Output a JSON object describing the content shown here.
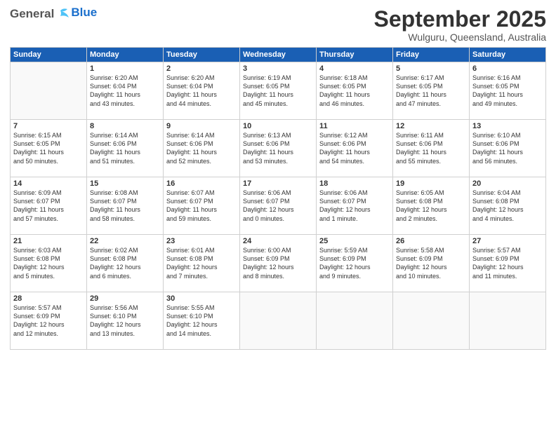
{
  "header": {
    "logo_general": "General",
    "logo_blue": "Blue",
    "month_title": "September 2025",
    "subtitle": "Wulguru, Queensland, Australia"
  },
  "days_of_week": [
    "Sunday",
    "Monday",
    "Tuesday",
    "Wednesday",
    "Thursday",
    "Friday",
    "Saturday"
  ],
  "weeks": [
    [
      {
        "day": "",
        "info": ""
      },
      {
        "day": "1",
        "info": "Sunrise: 6:20 AM\nSunset: 6:04 PM\nDaylight: 11 hours\nand 43 minutes."
      },
      {
        "day": "2",
        "info": "Sunrise: 6:20 AM\nSunset: 6:04 PM\nDaylight: 11 hours\nand 44 minutes."
      },
      {
        "day": "3",
        "info": "Sunrise: 6:19 AM\nSunset: 6:05 PM\nDaylight: 11 hours\nand 45 minutes."
      },
      {
        "day": "4",
        "info": "Sunrise: 6:18 AM\nSunset: 6:05 PM\nDaylight: 11 hours\nand 46 minutes."
      },
      {
        "day": "5",
        "info": "Sunrise: 6:17 AM\nSunset: 6:05 PM\nDaylight: 11 hours\nand 47 minutes."
      },
      {
        "day": "6",
        "info": "Sunrise: 6:16 AM\nSunset: 6:05 PM\nDaylight: 11 hours\nand 49 minutes."
      }
    ],
    [
      {
        "day": "7",
        "info": "Sunrise: 6:15 AM\nSunset: 6:05 PM\nDaylight: 11 hours\nand 50 minutes."
      },
      {
        "day": "8",
        "info": "Sunrise: 6:14 AM\nSunset: 6:06 PM\nDaylight: 11 hours\nand 51 minutes."
      },
      {
        "day": "9",
        "info": "Sunrise: 6:14 AM\nSunset: 6:06 PM\nDaylight: 11 hours\nand 52 minutes."
      },
      {
        "day": "10",
        "info": "Sunrise: 6:13 AM\nSunset: 6:06 PM\nDaylight: 11 hours\nand 53 minutes."
      },
      {
        "day": "11",
        "info": "Sunrise: 6:12 AM\nSunset: 6:06 PM\nDaylight: 11 hours\nand 54 minutes."
      },
      {
        "day": "12",
        "info": "Sunrise: 6:11 AM\nSunset: 6:06 PM\nDaylight: 11 hours\nand 55 minutes."
      },
      {
        "day": "13",
        "info": "Sunrise: 6:10 AM\nSunset: 6:06 PM\nDaylight: 11 hours\nand 56 minutes."
      }
    ],
    [
      {
        "day": "14",
        "info": "Sunrise: 6:09 AM\nSunset: 6:07 PM\nDaylight: 11 hours\nand 57 minutes."
      },
      {
        "day": "15",
        "info": "Sunrise: 6:08 AM\nSunset: 6:07 PM\nDaylight: 11 hours\nand 58 minutes."
      },
      {
        "day": "16",
        "info": "Sunrise: 6:07 AM\nSunset: 6:07 PM\nDaylight: 11 hours\nand 59 minutes."
      },
      {
        "day": "17",
        "info": "Sunrise: 6:06 AM\nSunset: 6:07 PM\nDaylight: 12 hours\nand 0 minutes."
      },
      {
        "day": "18",
        "info": "Sunrise: 6:06 AM\nSunset: 6:07 PM\nDaylight: 12 hours\nand 1 minute."
      },
      {
        "day": "19",
        "info": "Sunrise: 6:05 AM\nSunset: 6:08 PM\nDaylight: 12 hours\nand 2 minutes."
      },
      {
        "day": "20",
        "info": "Sunrise: 6:04 AM\nSunset: 6:08 PM\nDaylight: 12 hours\nand 4 minutes."
      }
    ],
    [
      {
        "day": "21",
        "info": "Sunrise: 6:03 AM\nSunset: 6:08 PM\nDaylight: 12 hours\nand 5 minutes."
      },
      {
        "day": "22",
        "info": "Sunrise: 6:02 AM\nSunset: 6:08 PM\nDaylight: 12 hours\nand 6 minutes."
      },
      {
        "day": "23",
        "info": "Sunrise: 6:01 AM\nSunset: 6:08 PM\nDaylight: 12 hours\nand 7 minutes."
      },
      {
        "day": "24",
        "info": "Sunrise: 6:00 AM\nSunset: 6:09 PM\nDaylight: 12 hours\nand 8 minutes."
      },
      {
        "day": "25",
        "info": "Sunrise: 5:59 AM\nSunset: 6:09 PM\nDaylight: 12 hours\nand 9 minutes."
      },
      {
        "day": "26",
        "info": "Sunrise: 5:58 AM\nSunset: 6:09 PM\nDaylight: 12 hours\nand 10 minutes."
      },
      {
        "day": "27",
        "info": "Sunrise: 5:57 AM\nSunset: 6:09 PM\nDaylight: 12 hours\nand 11 minutes."
      }
    ],
    [
      {
        "day": "28",
        "info": "Sunrise: 5:57 AM\nSunset: 6:09 PM\nDaylight: 12 hours\nand 12 minutes."
      },
      {
        "day": "29",
        "info": "Sunrise: 5:56 AM\nSunset: 6:10 PM\nDaylight: 12 hours\nand 13 minutes."
      },
      {
        "day": "30",
        "info": "Sunrise: 5:55 AM\nSunset: 6:10 PM\nDaylight: 12 hours\nand 14 minutes."
      },
      {
        "day": "",
        "info": ""
      },
      {
        "day": "",
        "info": ""
      },
      {
        "day": "",
        "info": ""
      },
      {
        "day": "",
        "info": ""
      }
    ]
  ]
}
